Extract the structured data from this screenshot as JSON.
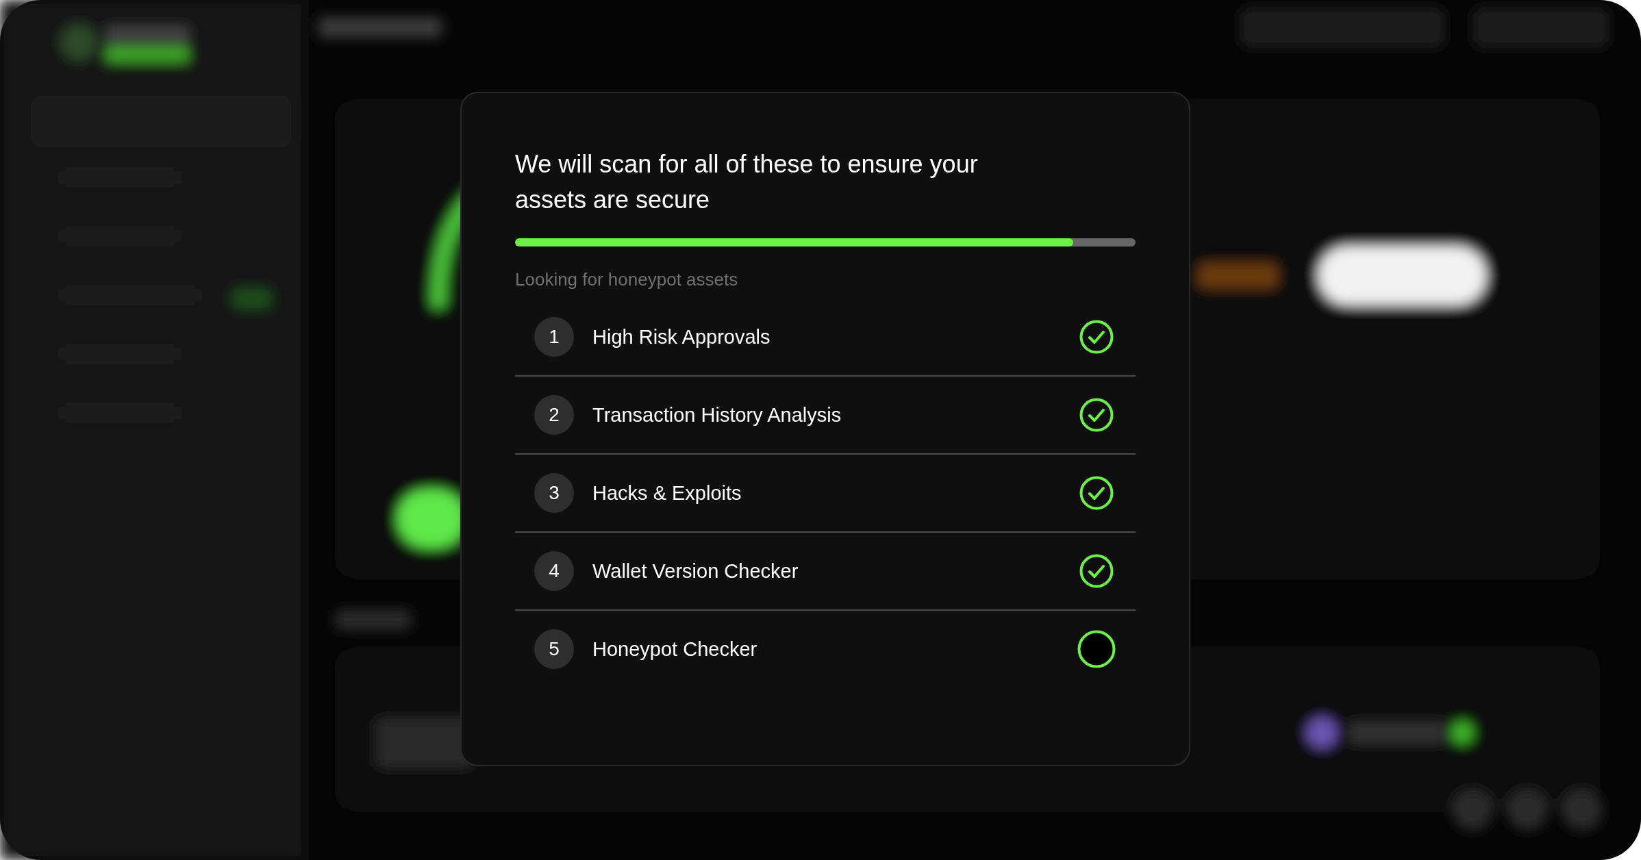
{
  "modal": {
    "title": "We will scan for all of these to ensure your assets are secure",
    "progress": {
      "level": 0.9
    },
    "status": "Looking for honeypot assets",
    "steps": [
      {
        "number": "1",
        "label": "High Risk Approvals",
        "done": true
      },
      {
        "number": "2",
        "label": "Transaction History Analysis",
        "done": true
      },
      {
        "number": "3",
        "label": "Hacks & Exploits",
        "done": true
      },
      {
        "number": "4",
        "label": "Wallet Version Checker",
        "done": true
      },
      {
        "number": "5",
        "label": "Honeypot Checker",
        "done": false
      }
    ]
  }
}
